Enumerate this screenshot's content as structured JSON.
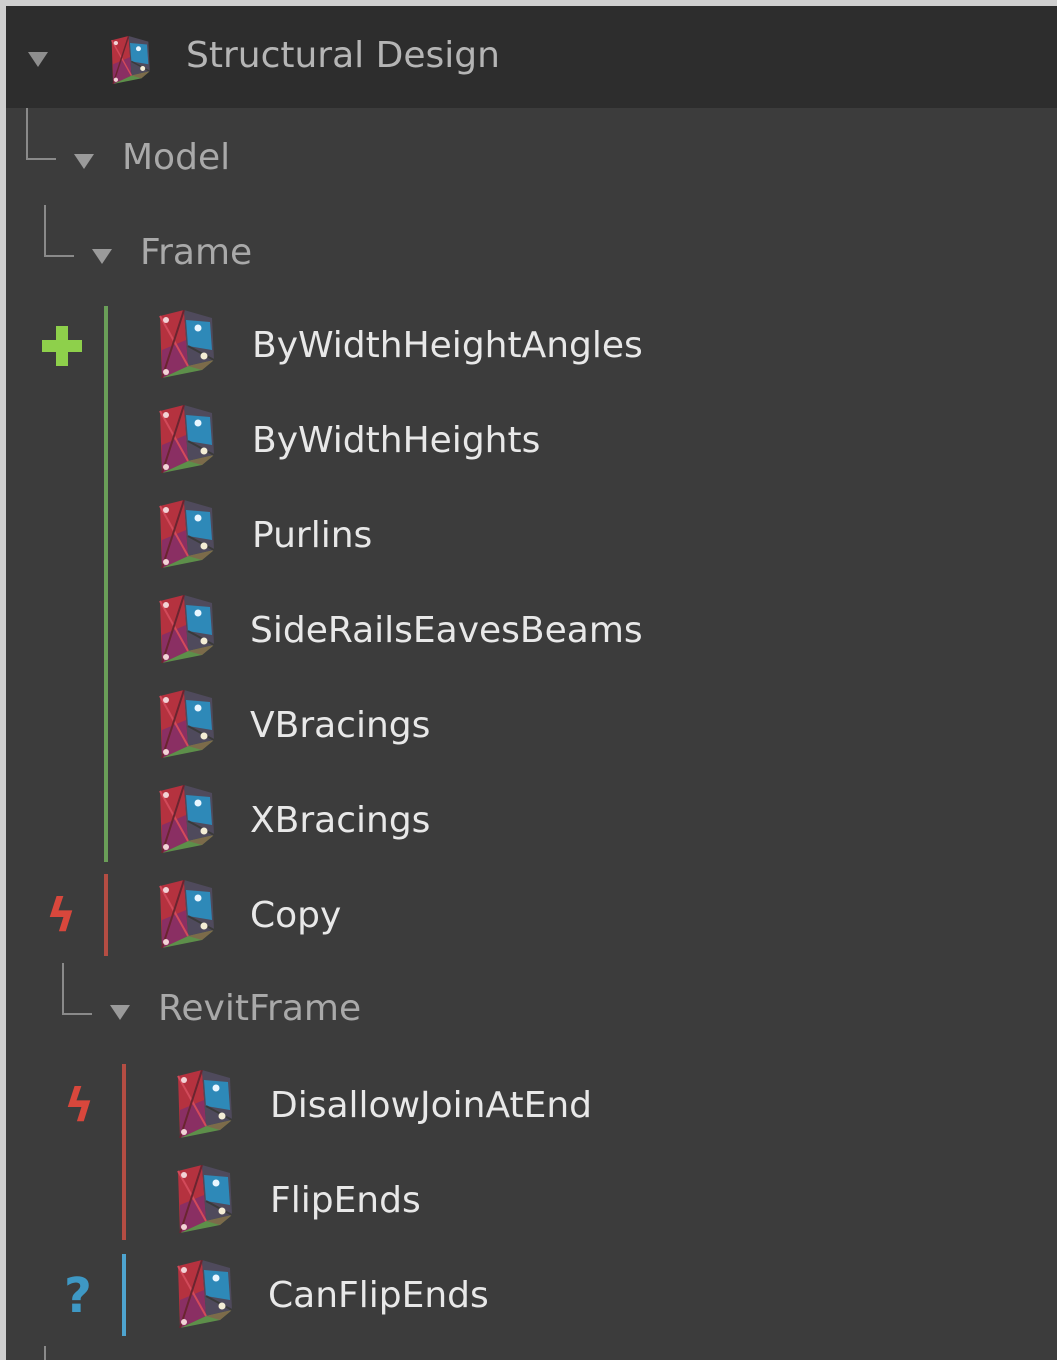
{
  "tree": {
    "root": {
      "label": "Structural Design",
      "icon": "dynamo-package-icon"
    },
    "model": {
      "label": "Model"
    },
    "frame": {
      "label": "Frame",
      "create_icon": "plus-icon",
      "create_color": "#8ed04b",
      "nodes": [
        {
          "label": "ByWidthHeightAngles",
          "icon": "dynamo-node-icon"
        },
        {
          "label": "ByWidthHeights",
          "icon": "dynamo-node-icon"
        },
        {
          "label": "Purlins",
          "icon": "dynamo-node-icon"
        },
        {
          "label": "SideRailsEavesBeams",
          "icon": "dynamo-node-icon"
        },
        {
          "label": "VBracings",
          "icon": "dynamo-node-icon"
        },
        {
          "label": "XBracings",
          "icon": "dynamo-node-icon"
        }
      ],
      "action_icon": "lightning-icon",
      "action_color": "#d8473c",
      "action_nodes": [
        {
          "label": "Copy",
          "icon": "dynamo-node-icon"
        }
      ]
    },
    "revit_frame": {
      "label": "RevitFrame",
      "action_icon": "lightning-icon",
      "action_color": "#d8473c",
      "action_nodes": [
        {
          "label": "DisallowJoinAtEnd",
          "icon": "dynamo-node-icon"
        },
        {
          "label": "FlipEnds",
          "icon": "dynamo-node-icon"
        }
      ],
      "query_icon": "question-mark-icon",
      "query_color": "#4ea4cf",
      "query_nodes": [
        {
          "label": "CanFlipEnds",
          "icon": "dynamo-node-icon"
        }
      ]
    }
  }
}
